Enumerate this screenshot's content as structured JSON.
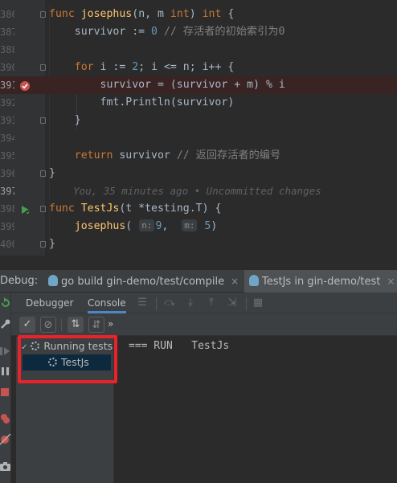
{
  "colors": {
    "annotation": "#e8232b",
    "breakpoint": "#c75450",
    "run": "#499c54",
    "accent": "#4a88c7"
  },
  "editor": {
    "lines": [
      {
        "num": "386",
        "code": "func josephus(n, m int) int {",
        "fold": true
      },
      {
        "num": "387",
        "code": "    survivor := 0 // 存活者的初始索引为0",
        "fold": false
      },
      {
        "num": "388",
        "code": "",
        "fold": false
      },
      {
        "num": "390",
        "code": "    for i := 2; i <= n; i++ {",
        "fold": true
      },
      {
        "num": "391",
        "code": "        survivor = (survivor + m) % i",
        "fold": false,
        "breakpoint": true
      },
      {
        "num": "392",
        "code": "        fmt.Println(survivor)",
        "fold": false
      },
      {
        "num": "393",
        "code": "    }",
        "fold": true
      },
      {
        "num": "394",
        "code": "",
        "fold": false
      },
      {
        "num": "395",
        "code": "    return survivor // 返回存活者的编号",
        "fold": false
      },
      {
        "num": "396",
        "code": "}",
        "fold": true
      },
      {
        "num": "397",
        "code": "    You, 35 minutes ago • Uncommitted changes",
        "fold": false,
        "current": true
      },
      {
        "num": "398",
        "code": "func TestJs(t *testing.T) {",
        "fold": true,
        "run": true
      },
      {
        "num": "399",
        "code": "    josephus( n: 9,  m: 5)",
        "fold": false
      },
      {
        "num": "400",
        "code": "}",
        "fold": true
      }
    ]
  },
  "debug": {
    "title": "Debug:",
    "tabs": [
      {
        "label": "go build gin-demo/test/compile",
        "close": "×"
      },
      {
        "label": "TestJs in gin-demo/test",
        "close": "×"
      }
    ],
    "subtabs": {
      "debugger": "Debugger",
      "console": "Console"
    },
    "more": "»",
    "tree": {
      "root": "Running tests",
      "child": "TestJs"
    },
    "console_output": "=== RUN   TestJs"
  }
}
